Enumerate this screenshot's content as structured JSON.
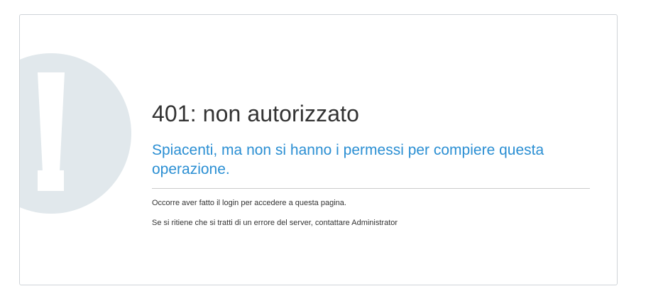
{
  "error": {
    "title": "401: non autorizzato",
    "subtitle": "Spiacenti, ma non si hanno i permessi per compiere questa operazione.",
    "messages": [
      "Occorre aver fatto il login per accedere a questa pagina.",
      "Se si ritiene che si tratti di un errore del server, contattare Administrator"
    ]
  },
  "icon": {
    "name": "exclamation-icon",
    "circle_color": "#e1e8ec",
    "glyph_color": "#ffffff"
  },
  "colors": {
    "title": "#333333",
    "subtitle": "#2b8fd3",
    "divider": "#cccccc",
    "border": "#cfd4d8"
  }
}
